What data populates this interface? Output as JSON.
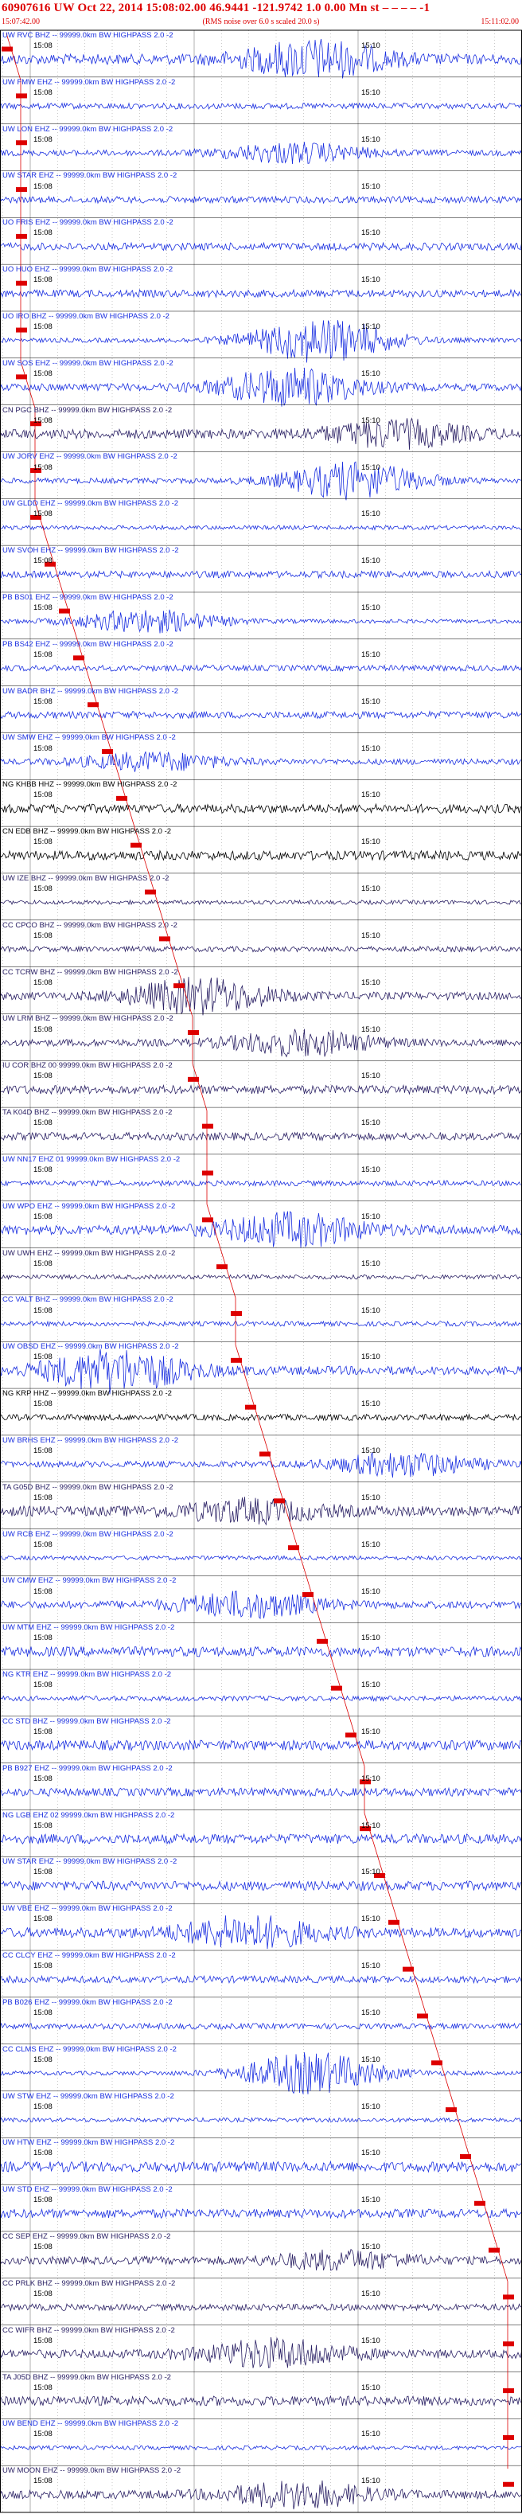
{
  "header": {
    "line1": "60907616 UW Oct 22, 2014 15:08:02.00   46.9441 -121.9742  1.0 0.00 Mn st – – – – -1",
    "scale_note": "(RMS noise over 6.0 s scaled 20.0 s)",
    "start_time": "15:07:42.00",
    "end_time": "15:11:02.00"
  },
  "colors": {
    "header_text": "#dd0000",
    "grid": "#222222",
    "pick": "#dd0000",
    "blue": "#1a2fe0",
    "navy": "#2a2064",
    "black": "#000000"
  },
  "time_ticks": {
    "minute_labels": [
      "15:08",
      "15:10"
    ]
  },
  "traces": [
    {
      "label": "UW RVC BHZ -- 99999.0km BW HIGHPASS 2.0 -2",
      "color": "blue",
      "pick_step": 0
    },
    {
      "label": "UW FMW EHZ -- 99999.0km BW HIGHPASS 2.0 -2",
      "color": "blue",
      "pick_step": 1
    },
    {
      "label": "UW LON EHZ -- 99999.0km BW HIGHPASS 2.0 -2",
      "color": "blue",
      "pick_step": 1
    },
    {
      "label": "UW STAR EHZ -- 99999.0km BW HIGHPASS 2.0 -2",
      "color": "blue",
      "pick_step": 1
    },
    {
      "label": "UO FRIS EHZ -- 99999.0km BW HIGHPASS 2.0 -2",
      "color": "blue",
      "pick_step": 1
    },
    {
      "label": "UO HUO EHZ -- 99999.0km BW HIGHPASS 2.0 -2",
      "color": "blue",
      "pick_step": 1
    },
    {
      "label": "UO IRO BHZ -- 99999.0km BW HIGHPASS 2.0 -2",
      "color": "blue",
      "pick_step": 1
    },
    {
      "label": "UW SOS EHZ -- 99999.0km BW HIGHPASS 2.0 -2",
      "color": "blue",
      "pick_step": 1
    },
    {
      "label": "CN PGC BHZ -- 99999.0km BW HIGHPASS 2.0 -2",
      "color": "navy",
      "pick_step": 2
    },
    {
      "label": "UW JORV EHZ -- 99999.0km BW HIGHPASS 2.0 -2",
      "color": "blue",
      "pick_step": 2
    },
    {
      "label": "UW GLDD EHZ -- 99999.0km BW HIGHPASS 2.0 -2",
      "color": "blue",
      "pick_step": 2
    },
    {
      "label": "UW SVOH EHZ -- 99999.0km BW HIGHPASS 2.0 -2",
      "color": "blue",
      "pick_step": 3
    },
    {
      "label": "PB BS01 EHZ -- 99999.0km BW HIGHPASS 2.0 -2",
      "color": "blue",
      "pick_step": 4
    },
    {
      "label": "PB BS42 EHZ -- 99999.0km BW HIGHPASS 2.0 -2",
      "color": "blue",
      "pick_step": 5
    },
    {
      "label": "UW BADR BHZ -- 99999.0km BW HIGHPASS 2.0 -2",
      "color": "blue",
      "pick_step": 6
    },
    {
      "label": "UW SMW EHZ -- 99999.0km BW HIGHPASS 2.0 -2",
      "color": "blue",
      "pick_step": 7
    },
    {
      "label": "NG KHBB HHZ -- 99999.0km BW HIGHPASS 2.0 -2",
      "color": "black",
      "pick_step": 8
    },
    {
      "label": "CN EDB BHZ -- 99999.0km BW HIGHPASS 2.0 -2",
      "color": "black",
      "pick_step": 9
    },
    {
      "label": "UW IZE BHZ -- 99999.0km BW HIGHPASS 2.0 -2",
      "color": "navy",
      "pick_step": 10
    },
    {
      "label": "CC CPCO BHZ -- 99999.0km BW HIGHPASS 2.0 -2",
      "color": "navy",
      "pick_step": 11
    },
    {
      "label": "CC TCRW BHZ -- 99999.0km BW HIGHPASS 2.0 -2",
      "color": "navy",
      "pick_step": 12
    },
    {
      "label": "UW LRM BHZ -- 99999.0km BW HIGHPASS 2.0 -2",
      "color": "navy",
      "pick_step": 13
    },
    {
      "label": "IU COR BHZ 00 99999.0km BW HIGHPASS 2.0 -2",
      "color": "navy",
      "pick_step": 13
    },
    {
      "label": "TA K04D BHZ -- 99999.0km BW HIGHPASS 2.0 -2",
      "color": "navy",
      "pick_step": 14
    },
    {
      "label": "UW NN17 EHZ 01 99999.0km BW HIGHPASS 2.0 -2",
      "color": "blue",
      "pick_step": 14
    },
    {
      "label": "UW WPO EHZ -- 99999.0km BW HIGHPASS 2.0 -2",
      "color": "blue",
      "pick_step": 14
    },
    {
      "label": "UW UWH EHZ -- 99999.0km BW HIGHPASS 2.0 -2",
      "color": "navy",
      "pick_step": 15
    },
    {
      "label": "CC VALT BHZ -- 99999.0km BW HIGHPASS 2.0 -2",
      "color": "blue",
      "pick_step": 16
    },
    {
      "label": "UW OBSD EHZ -- 99999.0km BW HIGHPASS 2.0 -2",
      "color": "blue",
      "pick_step": 16
    },
    {
      "label": "NG KRP HHZ -- 99999.0km BW HIGHPASS 2.0 -2",
      "color": "black",
      "pick_step": 17
    },
    {
      "label": "UW BRHS EHZ -- 99999.0km BW HIGHPASS 2.0 -2",
      "color": "blue",
      "pick_step": 18
    },
    {
      "label": "TA G05D BHZ -- 99999.0km BW HIGHPASS 2.0 -2",
      "color": "navy",
      "pick_step": 19
    },
    {
      "label": "UW RCB EHZ -- 99999.0km BW HIGHPASS 2.0 -2",
      "color": "blue",
      "pick_step": 20
    },
    {
      "label": "UW CMW EHZ -- 99999.0km BW HIGHPASS 2.0 -2",
      "color": "blue",
      "pick_step": 21
    },
    {
      "label": "UW MTM EHZ -- 99999.0km BW HIGHPASS 2.0 -2",
      "color": "blue",
      "pick_step": 22
    },
    {
      "label": "NG KTR EHZ -- 99999.0km BW HIGHPASS 2.0 -2",
      "color": "blue",
      "pick_step": 23
    },
    {
      "label": "CC STD BHZ -- 99999.0km BW HIGHPASS 2.0 -2",
      "color": "blue",
      "pick_step": 24
    },
    {
      "label": "PB B927 EHZ -- 99999.0km BW HIGHPASS 2.0 -2",
      "color": "blue",
      "pick_step": 25
    },
    {
      "label": "NG LGB EHZ 02 99999.0km BW HIGHPASS 2.0 -2",
      "color": "blue",
      "pick_step": 25
    },
    {
      "label": "UW STAR EHZ -- 99999.0km BW HIGHPASS 2.0 -2",
      "color": "blue",
      "pick_step": 26
    },
    {
      "label": "UW VBE EHZ -- 99999.0km BW HIGHPASS 2.0 -2",
      "color": "blue",
      "pick_step": 27
    },
    {
      "label": "CC CLCY EHZ -- 99999.0km BW HIGHPASS 2.0 -2",
      "color": "blue",
      "pick_step": 28
    },
    {
      "label": "PB B026 EHZ -- 99999.0km BW HIGHPASS 2.0 -2",
      "color": "blue",
      "pick_step": 29
    },
    {
      "label": "CC CLMS EHZ -- 99999.0km BW HIGHPASS 2.0 -2",
      "color": "blue",
      "pick_step": 30
    },
    {
      "label": "UW STW EHZ -- 99999.0km BW HIGHPASS 2.0 -2",
      "color": "blue",
      "pick_step": 31
    },
    {
      "label": "UW HTW EHZ -- 99999.0km BW HIGHPASS 2.0 -2",
      "color": "blue",
      "pick_step": 32
    },
    {
      "label": "UW STD EHZ -- 99999.0km BW HIGHPASS 2.0 -2",
      "color": "blue",
      "pick_step": 33
    },
    {
      "label": "CC SEP EHZ -- 99999.0km BW HIGHPASS 2.0 -2",
      "color": "navy",
      "pick_step": 34
    },
    {
      "label": "CC PRLK BHZ -- 99999.0km BW HIGHPASS 2.0 -2",
      "color": "navy",
      "pick_step": 35
    },
    {
      "label": "CC WIFR BHZ -- 99999.0km BW HIGHPASS 2.0 -2",
      "color": "navy",
      "pick_step": 35
    },
    {
      "label": "TA J05D BHZ -- 99999.0km BW HIGHPASS 2.0 -2",
      "color": "navy",
      "pick_step": 35
    },
    {
      "label": "UW BEND EHZ -- 99999.0km BW HIGHPASS 2.0 -2",
      "color": "blue",
      "pick_step": 35
    },
    {
      "label": "UW MOON EHZ -- 99999.0km BW HIGHPASS 2.0 -2",
      "color": "navy",
      "pick_step": 35
    }
  ]
}
